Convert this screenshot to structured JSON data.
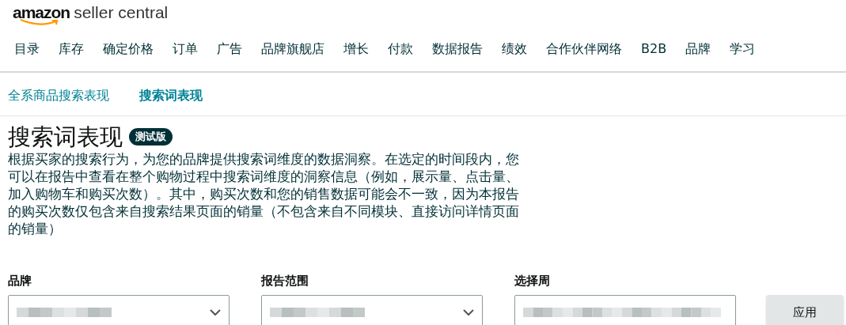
{
  "logo": {
    "brand": "amazon",
    "product": "seller central"
  },
  "nav": [
    {
      "label": "目录"
    },
    {
      "label": "库存"
    },
    {
      "label": "确定价格"
    },
    {
      "label": "订单"
    },
    {
      "label": "广告"
    },
    {
      "label": "品牌旗舰店"
    },
    {
      "label": "增长"
    },
    {
      "label": "付款"
    },
    {
      "label": "数据报告"
    },
    {
      "label": "绩效"
    },
    {
      "label": "合作伙伴网络"
    },
    {
      "label": "B2B"
    },
    {
      "label": "品牌"
    },
    {
      "label": "学习"
    }
  ],
  "subtabs": [
    {
      "label": "全系商品搜索表现",
      "selected": false
    },
    {
      "label": "搜索词表现",
      "selected": true
    }
  ],
  "title": "搜索词表现",
  "badge": "测试版",
  "description": "根据买家的搜索行为，为您的品牌提供搜索词维度的数据洞察。在选定的时间段内，您可以在报告中查看在整个购物过程中搜索词维度的洞察信息（例如，展示量、点击量、加入购物车和购买次数）。其中，购买次数和您的销售数据可能会不一致，因为本报告的购买次数仅包含来自搜索结果页面的销量（不包含来自不同模块、直接访问详情页面的销量）",
  "filters": [
    {
      "label": "品牌",
      "kind": "dropdown"
    },
    {
      "label": "报告范围",
      "kind": "dropdown"
    },
    {
      "label": "选择周",
      "kind": "field"
    }
  ],
  "apply_button": "应用"
}
